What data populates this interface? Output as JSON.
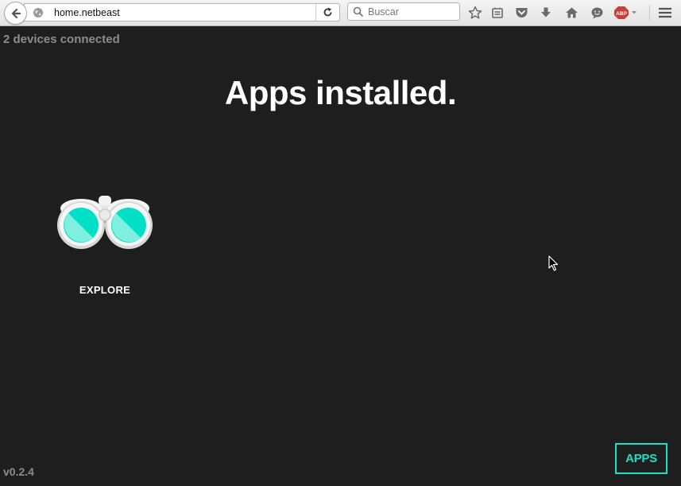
{
  "browser": {
    "url": "home.netbeast",
    "search_placeholder": "Buscar",
    "toolbar_icons": [
      "bookmark-star-icon",
      "reading-list-icon",
      "pocket-icon",
      "download-icon",
      "home-icon",
      "chat-icon",
      "adblock-icon",
      "hamburger-menu-icon"
    ],
    "adblock_label": "ABP"
  },
  "page": {
    "devices_status": "2 devices connected",
    "title": "Apps installed.",
    "apps": [
      {
        "name": "EXPLORE",
        "icon": "binoculars-icon"
      }
    ],
    "version": "v0.2.4",
    "apps_button": "APPS"
  },
  "colors": {
    "background": "#1e1e1e",
    "accent": "#1ce0c5",
    "muted_text": "#8c8c8c"
  }
}
